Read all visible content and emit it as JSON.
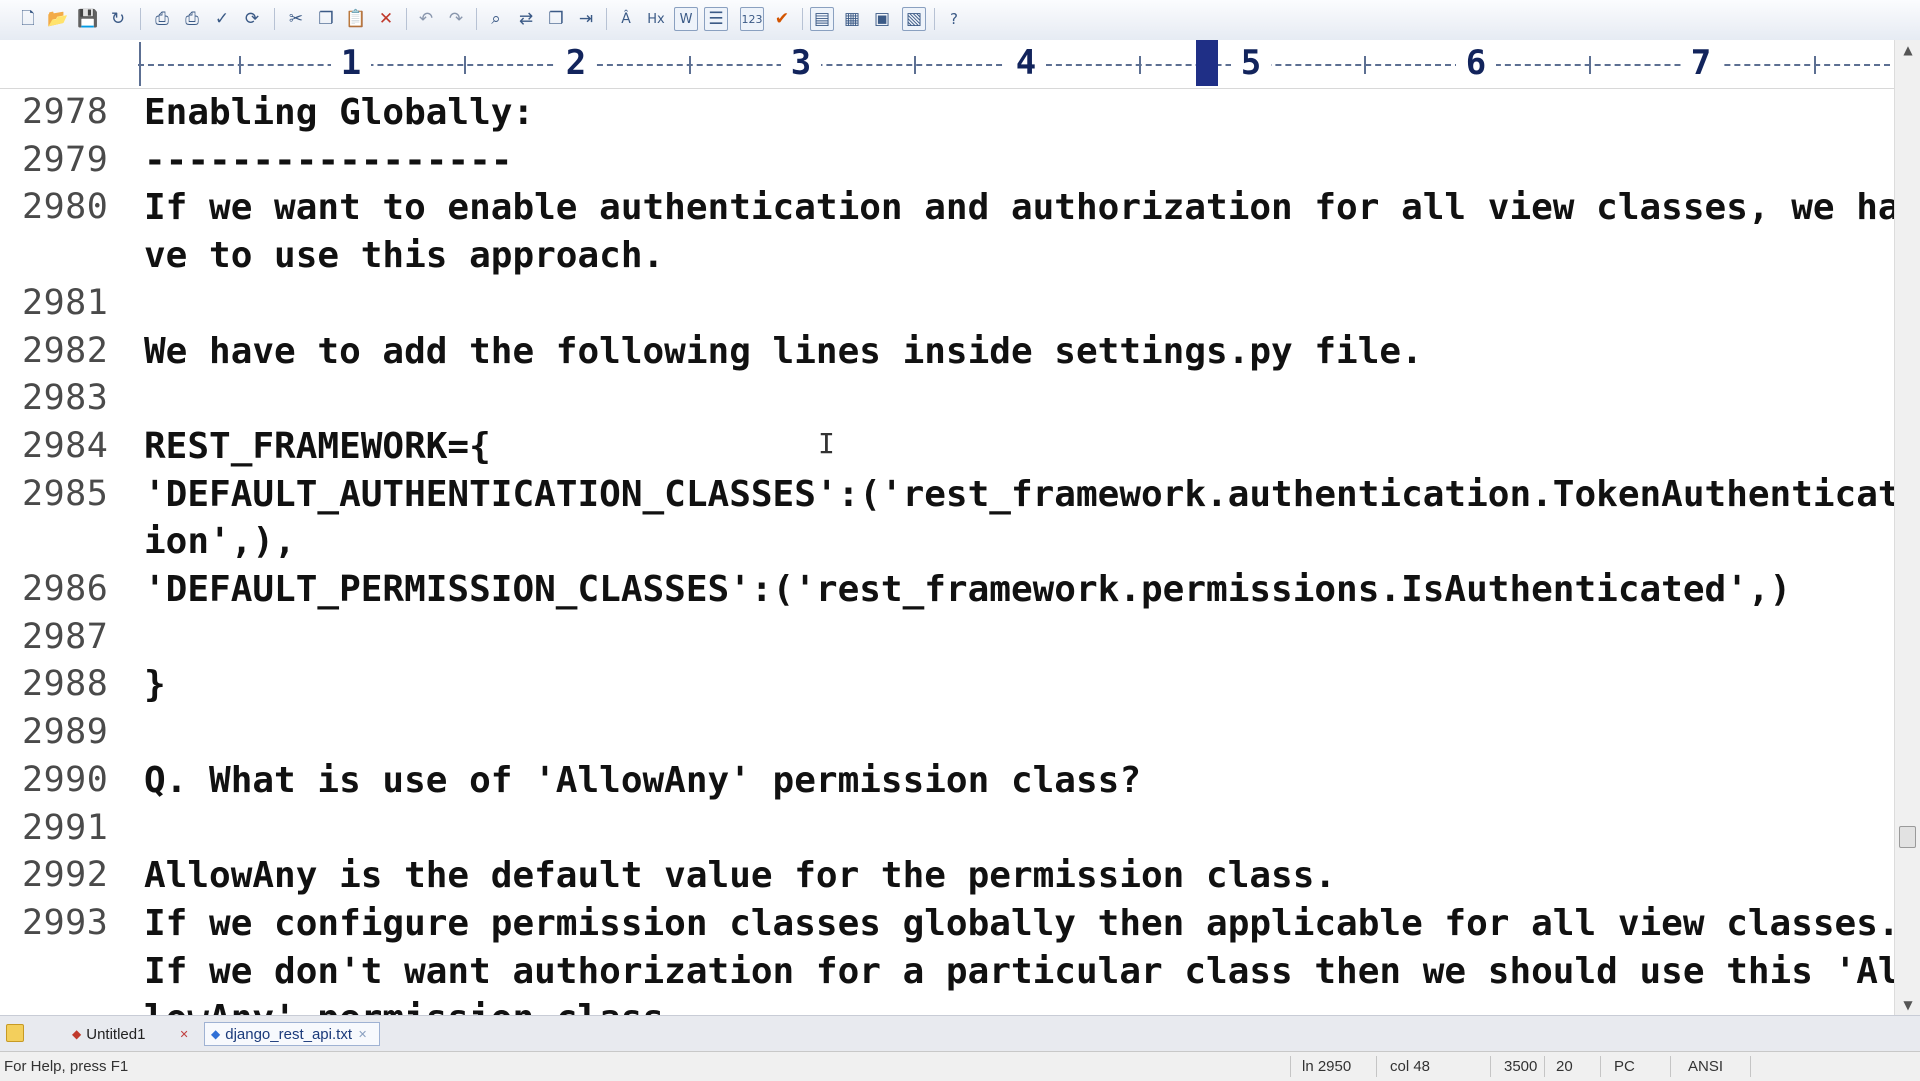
{
  "toolbar": {
    "icons": [
      "new-file",
      "open-file",
      "save",
      "save-all",
      "print-preview",
      "print",
      "spell-check",
      "refresh",
      "cut",
      "copy",
      "paste",
      "delete",
      "undo",
      "redo",
      "find",
      "replace",
      "find-in-files",
      "goto",
      "font",
      "hex-mode",
      "word-wrap",
      "line-numbers",
      "ruler",
      "spell-as-you-type",
      "toggle-panel",
      "toggle-toolbar",
      "toggle-output",
      "browser-view",
      "help"
    ]
  },
  "ruler": {
    "labels": [
      "1",
      "2",
      "3",
      "4",
      "5",
      "6",
      "7"
    ]
  },
  "editor": {
    "lines": [
      {
        "num": "2978",
        "text": "Enabling Globally:"
      },
      {
        "num": "2979",
        "text": "-----------------"
      },
      {
        "num": "2980",
        "text": "If we want to enable authentication and authorization for all view classes, we have to use this approach."
      },
      {
        "num": "2981",
        "text": ""
      },
      {
        "num": "2982",
        "text": "We have to add the following lines inside settings.py file."
      },
      {
        "num": "2983",
        "text": ""
      },
      {
        "num": "2984",
        "text": "REST_FRAMEWORK={"
      },
      {
        "num": "2985",
        "text": "'DEFAULT_AUTHENTICATION_CLASSES':('rest_framework.authentication.TokenAuthentication',),"
      },
      {
        "num": "2986",
        "text": "'DEFAULT_PERMISSION_CLASSES':('rest_framework.permissions.IsAuthenticated',)"
      },
      {
        "num": "2987",
        "text": ""
      },
      {
        "num": "2988",
        "text": "}"
      },
      {
        "num": "2989",
        "text": ""
      },
      {
        "num": "2990",
        "text": "Q. What is use of 'AllowAny' permission class?"
      },
      {
        "num": "2991",
        "text": ""
      },
      {
        "num": "2992",
        "text": "AllowAny is the default value for the permission class."
      },
      {
        "num": "2993",
        "text": "If we configure permission classes globally then applicable for all view classes. If we don't want authorization for a particular class then we should use this 'AllowAny' permission class."
      }
    ]
  },
  "tabs": [
    {
      "label": "Untitled1"
    },
    {
      "label": "django_rest_api.txt"
    }
  ],
  "status": {
    "help": "For Help, press F1",
    "line": "ln 2950",
    "col": "col 48",
    "total": "3500",
    "num": "20",
    "mode": "PC",
    "encoding": "ANSI"
  }
}
